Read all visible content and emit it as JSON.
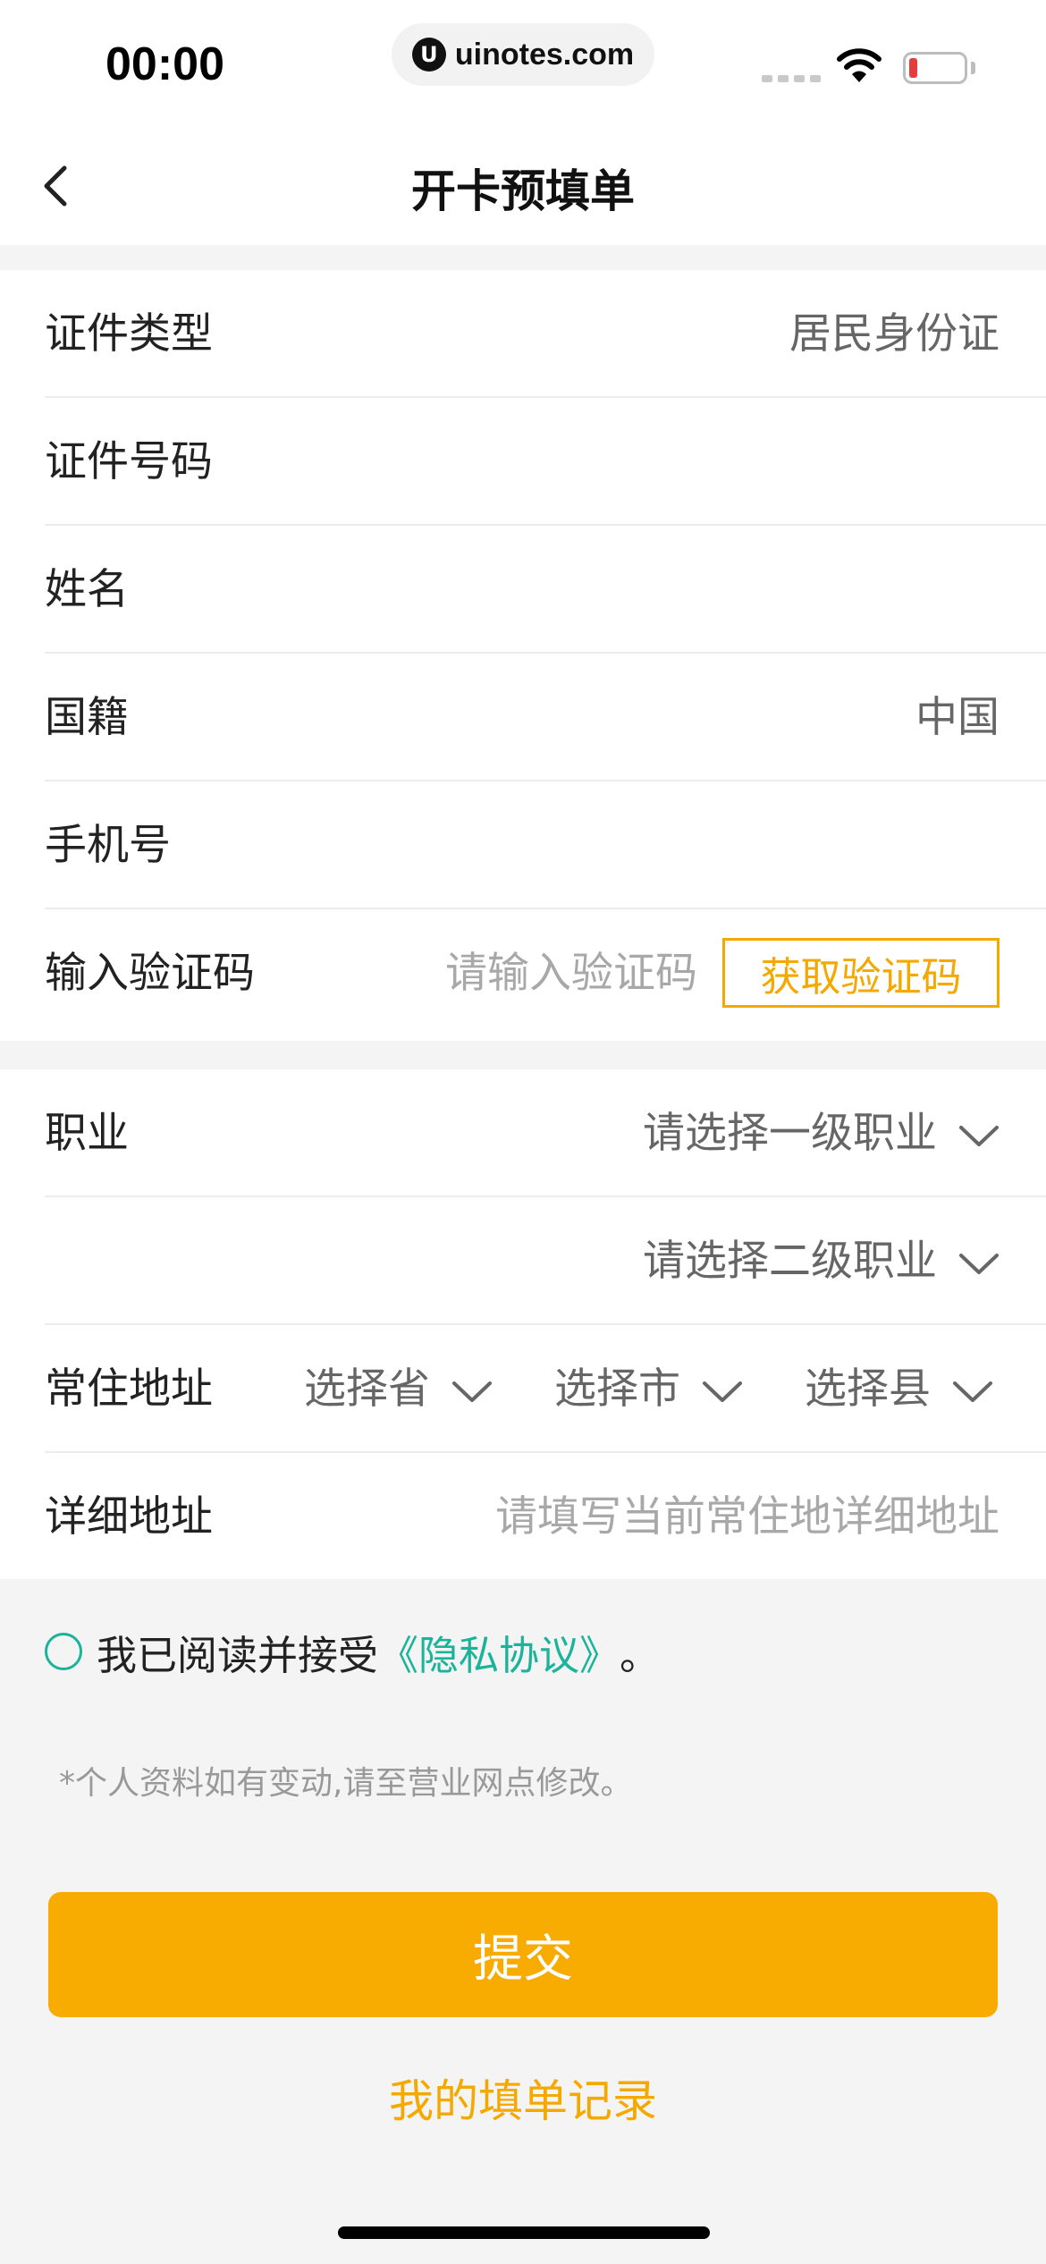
{
  "status_bar": {
    "time": "00:00",
    "url": "uinotes.com",
    "logo_glyph": "U"
  },
  "nav": {
    "title": "开卡预填单",
    "back_icon": "chevron-left-icon"
  },
  "section1": {
    "id_type": {
      "label": "证件类型",
      "value": "居民身份证"
    },
    "id_number": {
      "label": "证件号码",
      "value": ""
    },
    "name": {
      "label": "姓名",
      "value": ""
    },
    "nationality": {
      "label": "国籍",
      "value": "中国"
    },
    "phone": {
      "label": "手机号",
      "value": ""
    },
    "verify": {
      "label": "输入验证码",
      "placeholder": "请输入验证码",
      "button": "获取验证码"
    }
  },
  "section2": {
    "occupation": {
      "label": "职业",
      "level1_placeholder": "请选择一级职业",
      "level2_placeholder": "请选择二级职业"
    },
    "address": {
      "label": "常住地址",
      "province": "选择省",
      "city": "选择市",
      "county": "选择县"
    },
    "detail": {
      "label": "详细地址",
      "placeholder": "请填写当前常住地详细地址"
    }
  },
  "agreement": {
    "text": "我已阅读并接受",
    "link": "《隐私协议》",
    "suffix": "。"
  },
  "note": "*个人资料如有变动,请至营业网点修改。",
  "submit_label": "提交",
  "records_label": "我的填单记录",
  "colors": {
    "accent": "#f8ab00",
    "link": "#1bb49a"
  }
}
